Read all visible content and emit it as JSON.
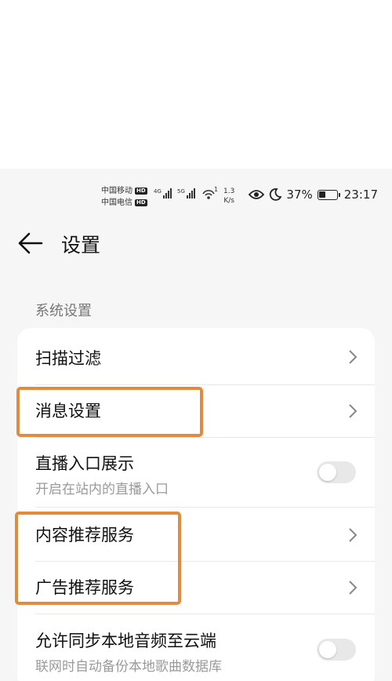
{
  "status_bar": {
    "carrier1": "中国移动",
    "carrier2": "中国电信",
    "hd": "HD",
    "net1": "4G",
    "net2": "5G",
    "wifi_num": "1",
    "speed_value": "1.3",
    "speed_unit": "K/s",
    "battery": "37%",
    "time": "23:17"
  },
  "header": {
    "title": "设置"
  },
  "section": {
    "label": "系统设置"
  },
  "items": [
    {
      "label": "扫描过滤",
      "type": "link"
    },
    {
      "label": "消息设置",
      "type": "link"
    },
    {
      "label": "直播入口展示",
      "sub": "开启在站内的直播入口",
      "type": "toggle",
      "on": false
    },
    {
      "label": "内容推荐服务",
      "type": "link"
    },
    {
      "label": "广告推荐服务",
      "type": "link"
    },
    {
      "label": "允许同步本地音频至云端",
      "sub": "联网时自动备份本地歌曲数据库",
      "type": "toggle",
      "on": false
    }
  ],
  "colors": {
    "highlight": "#e58a3a",
    "background": "#f6f6f6"
  }
}
